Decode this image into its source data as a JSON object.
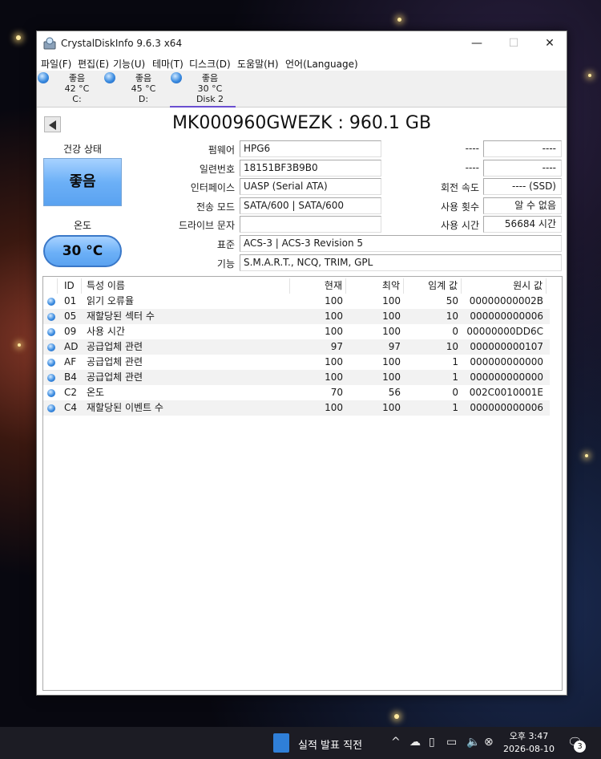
{
  "window": {
    "title": "CrystalDiskInfo 9.6.3 x64",
    "minimize": "—",
    "maximize": "☐",
    "close": "✕"
  },
  "menu": [
    "파일(F)",
    "편집(E)",
    "기능(U)",
    "테마(T)",
    "디스크(D)",
    "도움말(H)",
    "언어(Language)"
  ],
  "disks": [
    {
      "status": "좋음",
      "temp": "42 °C",
      "name": "C:"
    },
    {
      "status": "좋음",
      "temp": "45 °C",
      "name": "D:"
    },
    {
      "status": "좋음",
      "temp": "30 °C",
      "name": "Disk 2"
    }
  ],
  "model_title": "MK000960GWEZK : 960.1 GB",
  "health": {
    "label": "건강 상태",
    "value": "좋음"
  },
  "temperature": {
    "label": "온도",
    "value": "30 °C"
  },
  "info": {
    "firmware_label": "펌웨어",
    "firmware": "HPG6",
    "serial_label": "일련번호",
    "serial": "18151BF3B9B0",
    "interface_label": "인터페이스",
    "interface": "UASP (Serial ATA)",
    "transfer_label": "전송 모드",
    "transfer": "SATA/600 | SATA/600",
    "drive_letter_label": "드라이브 문자",
    "drive_letter": "",
    "standard_label": "표준",
    "standard": "ACS-3 | ACS-3 Revision 5",
    "features_label": "기능",
    "features": "S.M.A.R.T., NCQ, TRIM, GPL",
    "right1_label": "----",
    "right1": "----",
    "right2_label": "----",
    "right2": "----",
    "rotation_label": "회전 속도",
    "rotation": "---- (SSD)",
    "power_count_label": "사용 횟수",
    "power_count": "알 수 없음",
    "power_hours_label": "사용 시간",
    "power_hours": "56684 시간"
  },
  "smart": {
    "headers": {
      "id": "ID",
      "name": "특성 이름",
      "current": "현재",
      "worst": "최악",
      "threshold": "임계 값",
      "raw": "원시 값"
    },
    "rows": [
      {
        "id": "01",
        "name": "읽기 오류율",
        "current": "100",
        "worst": "100",
        "threshold": "50",
        "raw": "00000000002B"
      },
      {
        "id": "05",
        "name": "재할당된 섹터 수",
        "current": "100",
        "worst": "100",
        "threshold": "10",
        "raw": "000000000006"
      },
      {
        "id": "09",
        "name": "사용 시간",
        "current": "100",
        "worst": "100",
        "threshold": "0",
        "raw": "00000000DD6C"
      },
      {
        "id": "AD",
        "name": "공급업체 관련",
        "current": "97",
        "worst": "97",
        "threshold": "10",
        "raw": "000000000107"
      },
      {
        "id": "AF",
        "name": "공급업체 관련",
        "current": "100",
        "worst": "100",
        "threshold": "1",
        "raw": "000000000000"
      },
      {
        "id": "B4",
        "name": "공급업체 관련",
        "current": "100",
        "worst": "100",
        "threshold": "1",
        "raw": "000000000000"
      },
      {
        "id": "C2",
        "name": "온도",
        "current": "70",
        "worst": "56",
        "threshold": "0",
        "raw": "002C0010001E"
      },
      {
        "id": "C4",
        "name": "재할당된 이벤트 수",
        "current": "100",
        "worst": "100",
        "threshold": "1",
        "raw": "000000000006"
      }
    ]
  },
  "taskbar": {
    "app_label": "실적 발표 직전",
    "chevron": "^",
    "time": "오후 3:47",
    "date": "2026-08-10",
    "notification_count": "3"
  }
}
